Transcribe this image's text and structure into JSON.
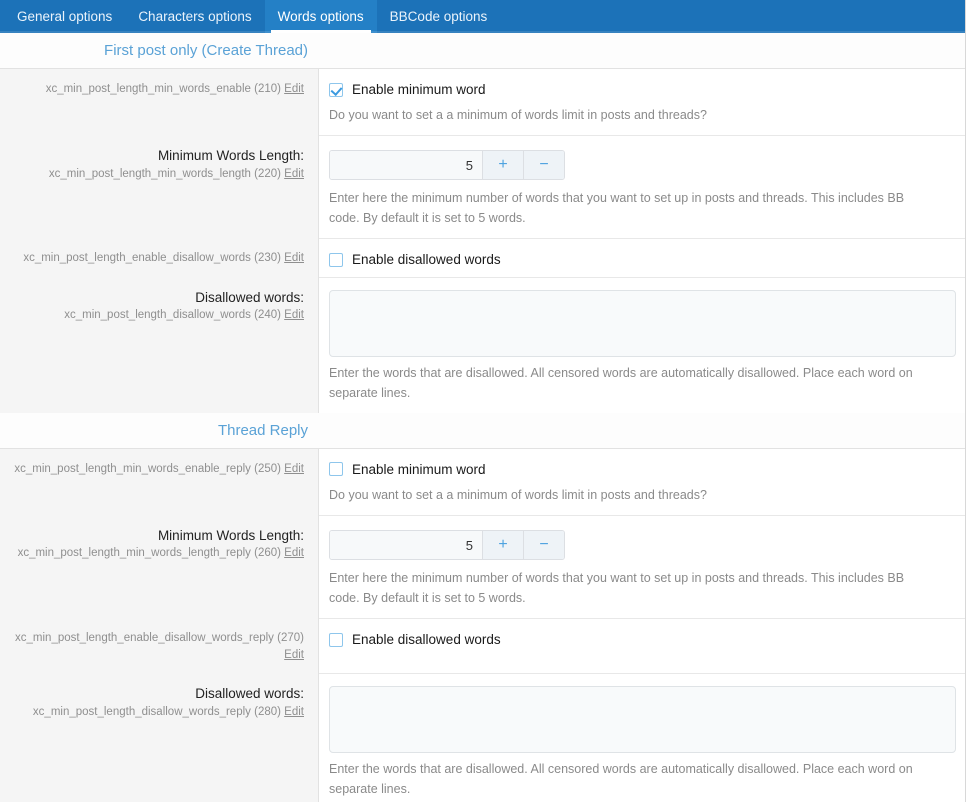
{
  "tabs": [
    {
      "label": "General options",
      "active": false
    },
    {
      "label": "Characters options",
      "active": false
    },
    {
      "label": "Words options",
      "active": true
    },
    {
      "label": "BBCode options",
      "active": false
    }
  ],
  "edit_label": "Edit",
  "colors": {
    "tabbar_bg": "#1c72b8",
    "tab_active_bg": "#2480c6",
    "section_title": "#5aa2d6",
    "checkbox_border": "#8ec6ec",
    "checkbox_check": "#3b9ae0",
    "stepper_button": "#4ea3e0",
    "label_column_bg": "#f5f5f5"
  },
  "sections": [
    {
      "title": "First post only (Create Thread)",
      "rows": [
        {
          "label_title": "",
          "option_key": "xc_min_post_length_min_words_enable",
          "option_id": "(210)",
          "control": "checkbox",
          "checkbox_label": "Enable minimum word",
          "checked": true,
          "help": "Do you want to set a a minimum of words limit in posts and threads?"
        },
        {
          "label_title": "Minimum Words Length:",
          "option_key": "xc_min_post_length_min_words_length",
          "option_id": "(220)",
          "control": "stepper",
          "value": "5",
          "plus_label": "+",
          "minus_label": "−",
          "help": "Enter here the minimum number of words that you want to set up in posts and threads. This includes BB code. By default it is set to 5 words."
        },
        {
          "label_title": "",
          "option_key": "xc_min_post_length_enable_disallow_words",
          "option_id": "(230)",
          "control": "checkbox",
          "checkbox_label": "Enable disallowed words",
          "checked": false,
          "help": ""
        },
        {
          "label_title": "Disallowed words:",
          "option_key": "xc_min_post_length_disallow_words",
          "option_id": "(240)",
          "control": "textarea",
          "value": "",
          "help": "Enter the words that are disallowed. All censored words are automatically disallowed. Place each word on separate lines."
        }
      ]
    },
    {
      "title": "Thread Reply",
      "rows": [
        {
          "label_title": "",
          "option_key": "xc_min_post_length_min_words_enable_reply",
          "option_id": "(250)",
          "control": "checkbox",
          "checkbox_label": "Enable minimum word",
          "checked": false,
          "help": "Do you want to set a a minimum of words limit in posts and threads?"
        },
        {
          "label_title": "Minimum Words Length:",
          "option_key": "xc_min_post_length_min_words_length_reply",
          "option_id": "(260)",
          "control": "stepper",
          "value": "5",
          "plus_label": "+",
          "minus_label": "−",
          "help": "Enter here the minimum number of words that you want to set up in posts and threads. This includes BB code. By default it is set to 5 words."
        },
        {
          "label_title": "",
          "option_key": "xc_min_post_length_enable_disallow_words_reply",
          "option_id": "(270)",
          "control": "checkbox",
          "checkbox_label": "Enable disallowed words",
          "checked": false,
          "help": ""
        },
        {
          "label_title": "Disallowed words:",
          "option_key": "xc_min_post_length_disallow_words_reply",
          "option_id": "(280)",
          "control": "textarea",
          "value": "",
          "help": "Enter the words that are disallowed. All censored words are automatically disallowed. Place each word on separate lines."
        }
      ]
    }
  ]
}
